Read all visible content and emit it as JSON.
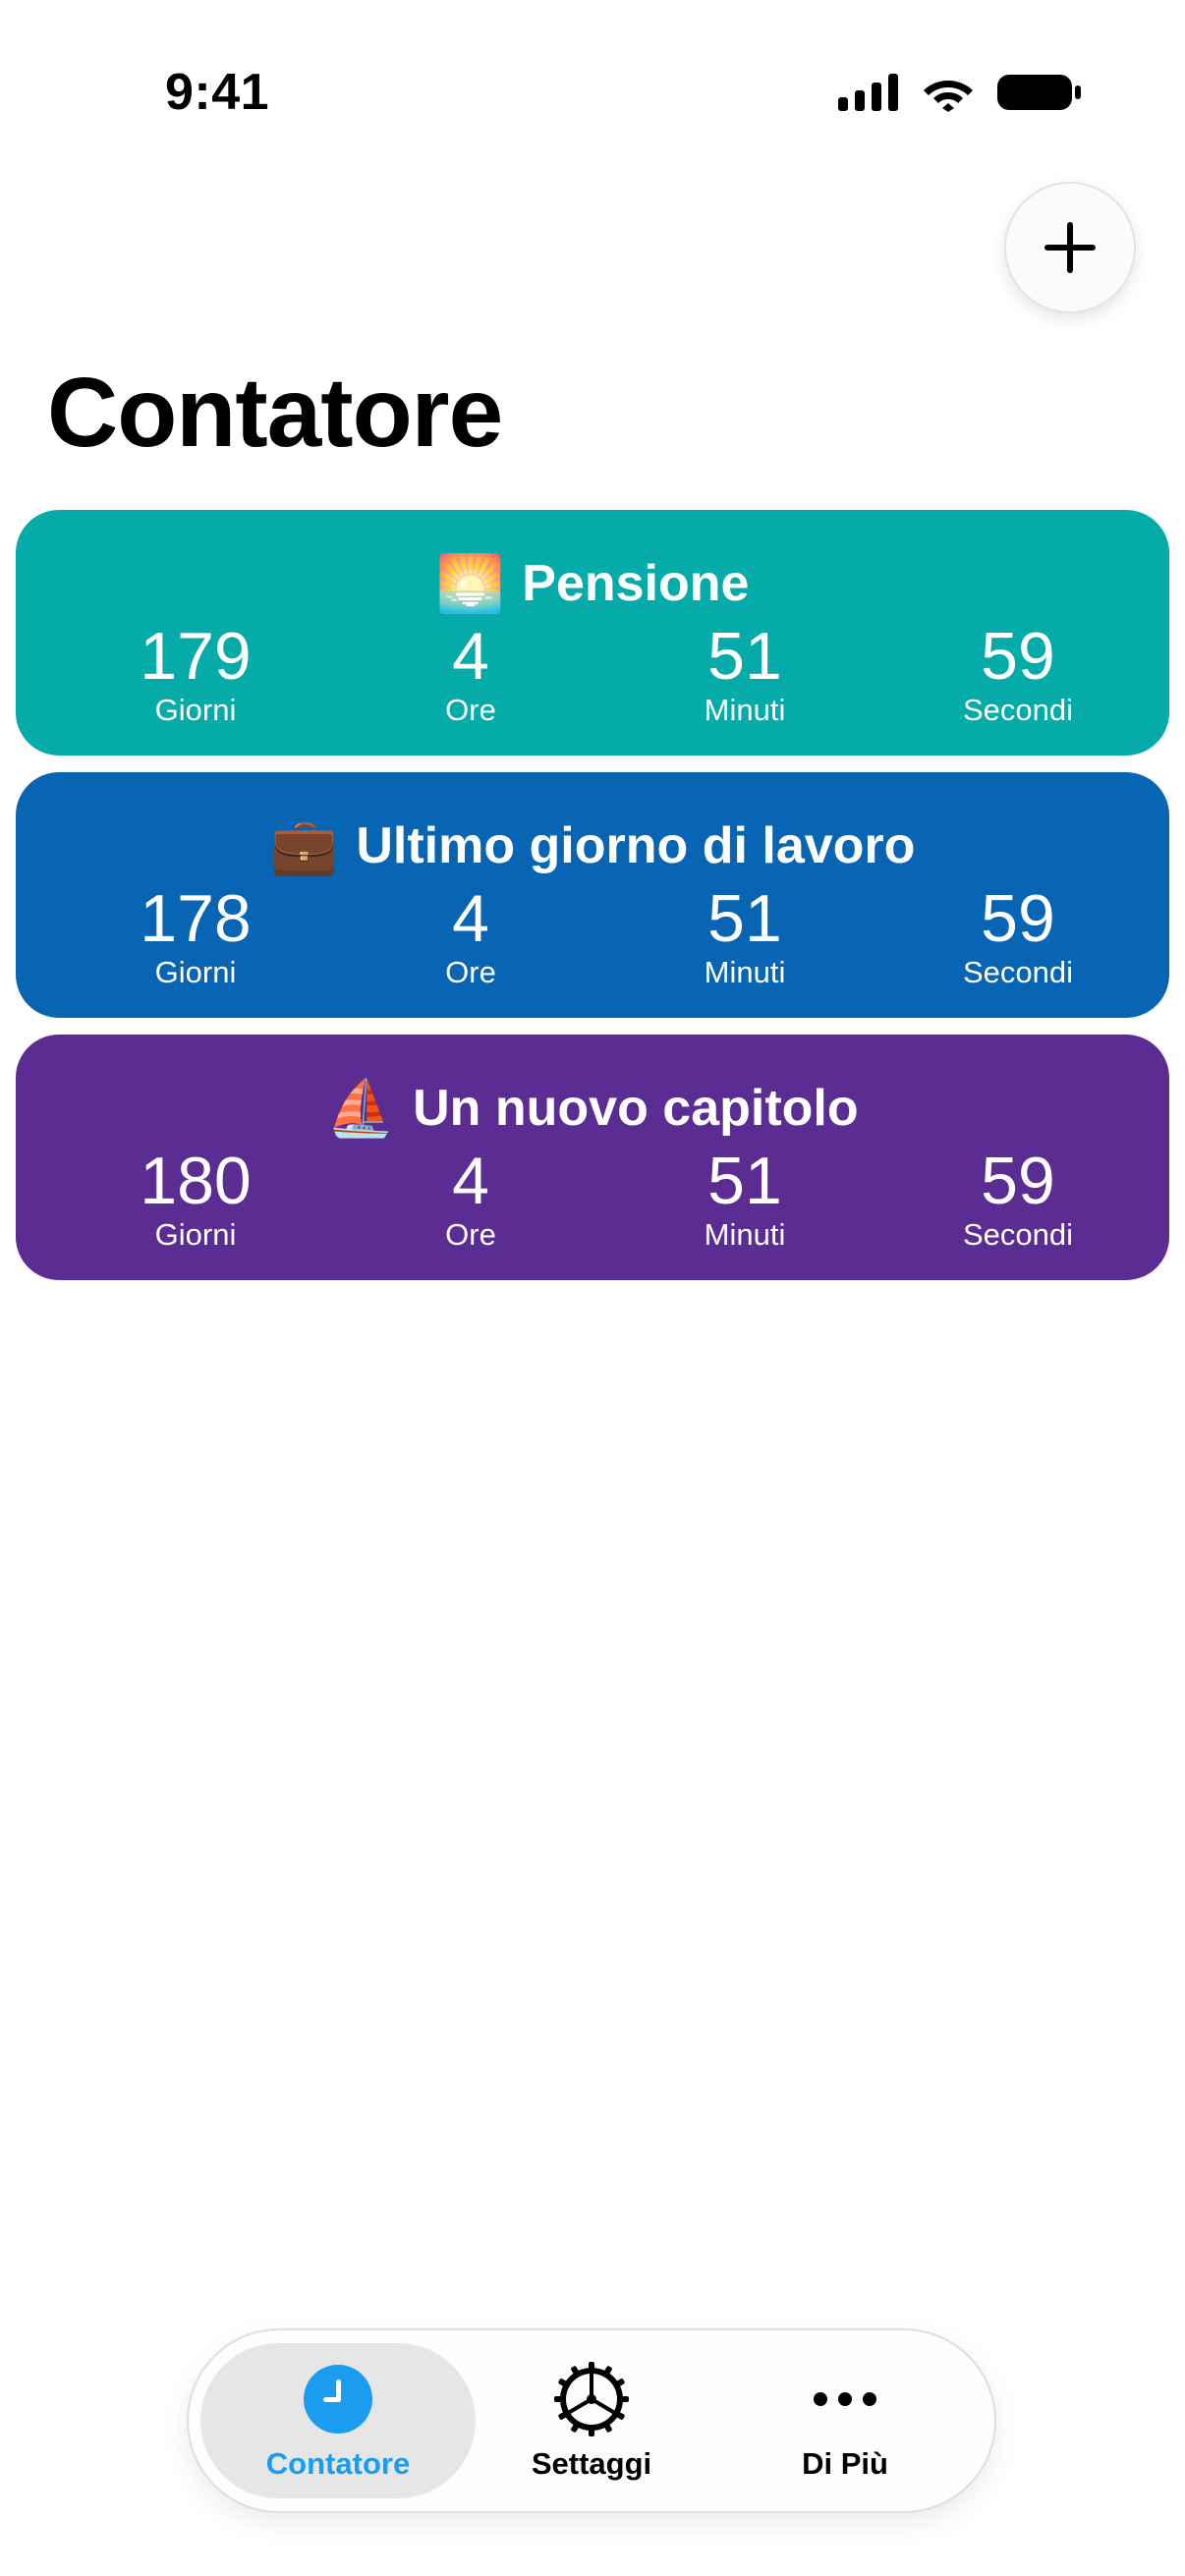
{
  "status_bar": {
    "time": "9:41"
  },
  "header": {
    "title": "Contatore",
    "add_button_icon": "plus-icon"
  },
  "counters": [
    {
      "emoji": "🌅",
      "title": "Pensione",
      "color": "#05ABA8",
      "values": {
        "days": "179",
        "hours": "4",
        "minutes": "51",
        "seconds": "59"
      }
    },
    {
      "emoji": "💼",
      "title": "Ultimo giorno di lavoro",
      "color": "#0765B3",
      "values": {
        "days": "178",
        "hours": "4",
        "minutes": "51",
        "seconds": "59"
      }
    },
    {
      "emoji": "⛵",
      "title": "Un nuovo capitolo",
      "color": "#5B2D92",
      "values": {
        "days": "180",
        "hours": "4",
        "minutes": "51",
        "seconds": "59"
      }
    }
  ],
  "units": {
    "days": "Giorni",
    "hours": "Ore",
    "minutes": "Minuti",
    "seconds": "Secondi"
  },
  "tab_bar": {
    "accent": "#1A9DF0",
    "tabs": [
      {
        "label": "Contatore",
        "icon": "clock-icon",
        "active": true
      },
      {
        "label": "Settaggi",
        "icon": "gear-icon",
        "active": false
      },
      {
        "label": "Di Più",
        "icon": "more-icon",
        "active": false
      }
    ]
  }
}
